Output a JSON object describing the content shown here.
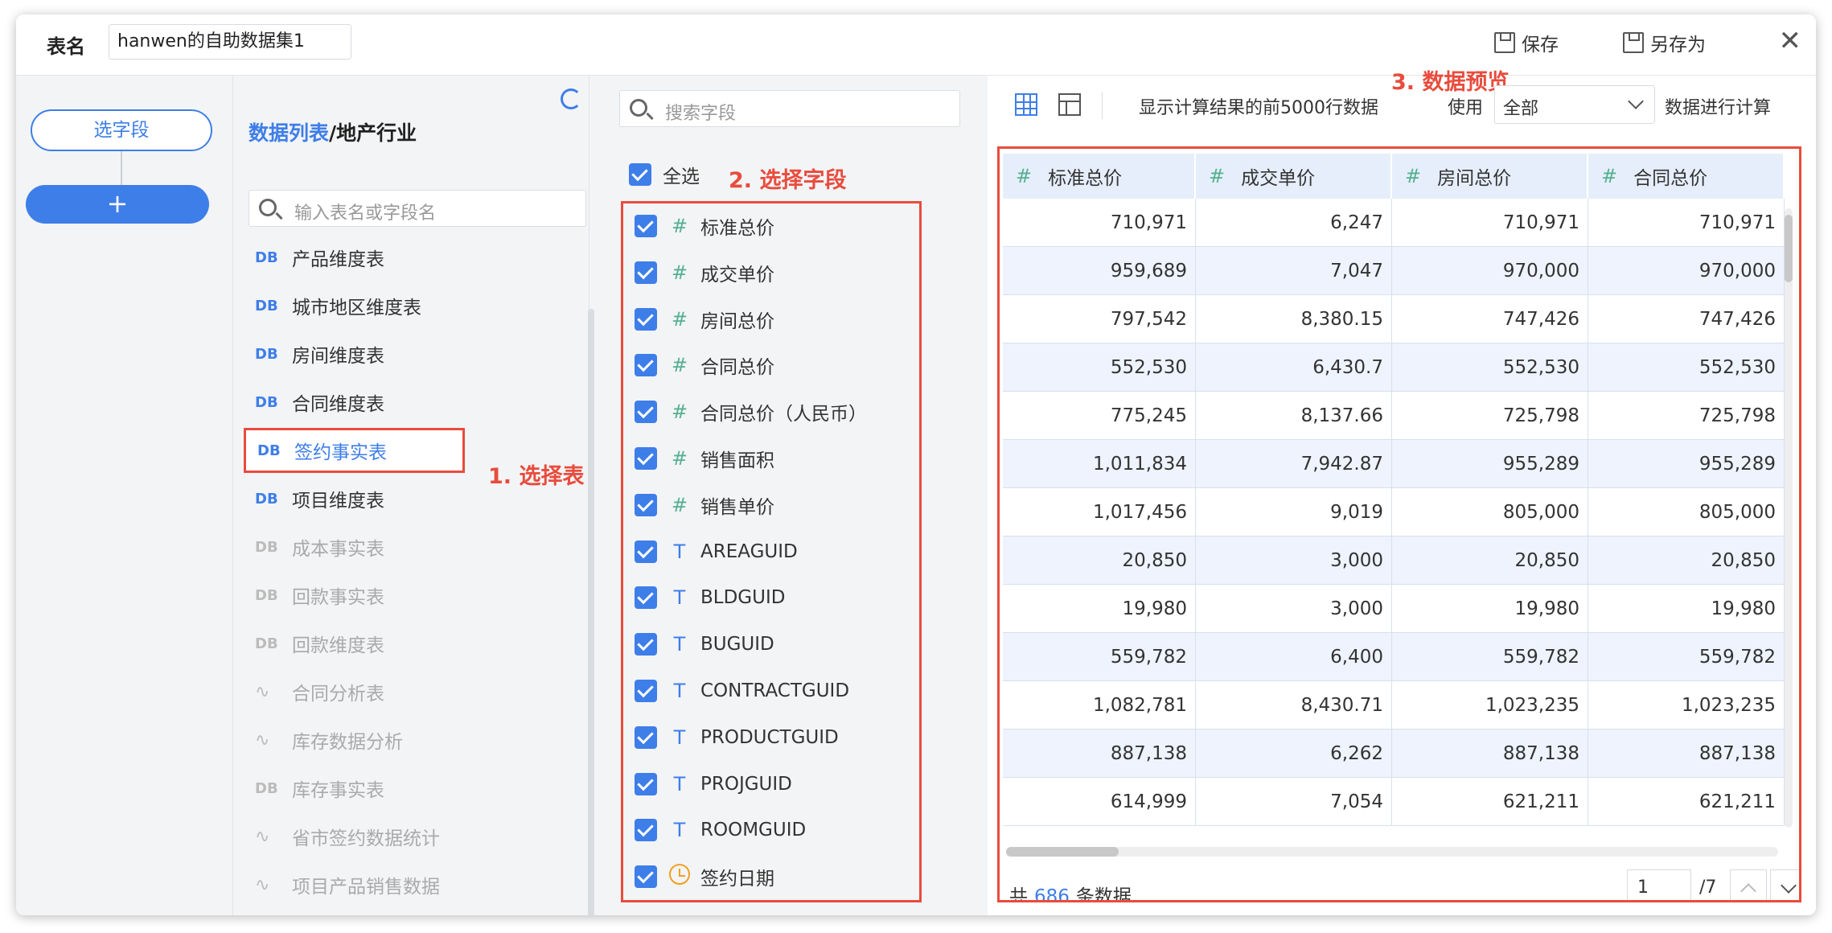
{
  "header": {
    "name_label": "表名",
    "name_value": "hanwen的自助数据集1",
    "save_label": "保存",
    "save_as_label": "另存为",
    "close_label": "✕"
  },
  "steps": {
    "select_field_label": "选字段",
    "add_label": "+"
  },
  "tables": {
    "title_prefix": "数据列表",
    "title_suffix": "/地产行业",
    "search_placeholder": "输入表名或字段名",
    "annotation": "1. 选择表",
    "items": [
      {
        "type": "DB",
        "label": "产品维度表",
        "disabled": false
      },
      {
        "type": "DB",
        "label": "城市地区维度表",
        "disabled": false
      },
      {
        "type": "DB",
        "label": "房间维度表",
        "disabled": false
      },
      {
        "type": "DB",
        "label": "合同维度表",
        "disabled": false
      },
      {
        "type": "DB",
        "label": "签约事实表",
        "disabled": false,
        "selected": true
      },
      {
        "type": "DB",
        "label": "项目维度表",
        "disabled": false
      },
      {
        "type": "DB",
        "label": "成本事实表",
        "disabled": true
      },
      {
        "type": "DB",
        "label": "回款事实表",
        "disabled": true
      },
      {
        "type": "DB",
        "label": "回款维度表",
        "disabled": true
      },
      {
        "type": "link",
        "label": "合同分析表",
        "disabled": true
      },
      {
        "type": "link",
        "label": "库存数据分析",
        "disabled": true
      },
      {
        "type": "DB",
        "label": "库存事实表",
        "disabled": true
      },
      {
        "type": "link",
        "label": "省市签约数据统计",
        "disabled": true
      },
      {
        "type": "link",
        "label": "项目产品销售数据",
        "disabled": true
      }
    ]
  },
  "fields": {
    "search_placeholder": "搜索字段",
    "select_all_label": "全选",
    "annotation": "2. 选择字段",
    "items": [
      {
        "type": "#",
        "kind": "num",
        "label": "标准总价"
      },
      {
        "type": "#",
        "kind": "num",
        "label": "成交单价"
      },
      {
        "type": "#",
        "kind": "num",
        "label": "房间总价"
      },
      {
        "type": "#",
        "kind": "num",
        "label": "合同总价"
      },
      {
        "type": "#",
        "kind": "num",
        "label": "合同总价（人民币）"
      },
      {
        "type": "#",
        "kind": "num",
        "label": "销售面积"
      },
      {
        "type": "#",
        "kind": "num",
        "label": "销售单价"
      },
      {
        "type": "T",
        "kind": "txt",
        "label": "AREAGUID"
      },
      {
        "type": "T",
        "kind": "txt",
        "label": "BLDGUID"
      },
      {
        "type": "T",
        "kind": "txt",
        "label": "BUGUID"
      },
      {
        "type": "T",
        "kind": "txt",
        "label": "CONTRACTGUID"
      },
      {
        "type": "T",
        "kind": "txt",
        "label": "PRODUCTGUID"
      },
      {
        "type": "T",
        "kind": "txt",
        "label": "PROJGUID"
      },
      {
        "type": "T",
        "kind": "txt",
        "label": "ROOMGUID"
      },
      {
        "type": "clock",
        "kind": "date",
        "label": "签约日期"
      }
    ]
  },
  "preview": {
    "annotation": "3. 数据预览",
    "info": "显示计算结果的前5000行数据",
    "use_label": "使用",
    "use_value": "全部",
    "calc_label": "数据进行计算",
    "columns": [
      "标准总价",
      "成交单价",
      "房间总价",
      "合同总价"
    ],
    "rows": [
      [
        "710,971",
        "6,247",
        "710,971",
        "710,971"
      ],
      [
        "959,689",
        "7,047",
        "970,000",
        "970,000"
      ],
      [
        "797,542",
        "8,380.15",
        "747,426",
        "747,426"
      ],
      [
        "552,530",
        "6,430.7",
        "552,530",
        "552,530"
      ],
      [
        "775,245",
        "8,137.66",
        "725,798",
        "725,798"
      ],
      [
        "1,011,834",
        "7,942.87",
        "955,289",
        "955,289"
      ],
      [
        "1,017,456",
        "9,019",
        "805,000",
        "805,000"
      ],
      [
        "20,850",
        "3,000",
        "20,850",
        "20,850"
      ],
      [
        "19,980",
        "3,000",
        "19,980",
        "19,980"
      ],
      [
        "559,782",
        "6,400",
        "559,782",
        "559,782"
      ],
      [
        "1,082,781",
        "8,430.71",
        "1,023,235",
        "1,023,235"
      ],
      [
        "887,138",
        "6,262",
        "887,138",
        "887,138"
      ],
      [
        "614,999",
        "7,054",
        "621,211",
        "621,211"
      ]
    ],
    "footer_prefix": "共",
    "total_count": "686",
    "footer_suffix": "条数据",
    "page_value": "1",
    "page_total": "/7"
  },
  "colors": {
    "accent": "#3e7ee8",
    "annotation": "#e84c3d",
    "number_type": "#55b090",
    "date_type": "#f0a020"
  }
}
